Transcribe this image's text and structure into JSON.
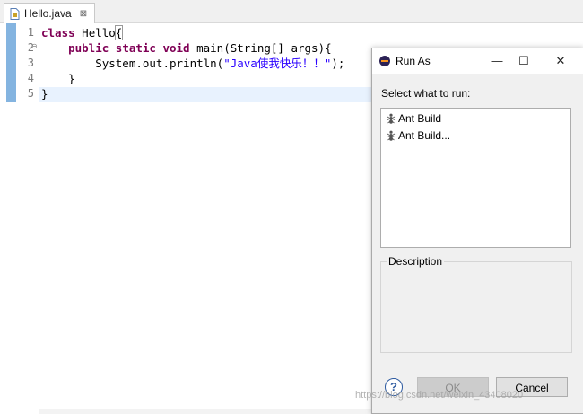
{
  "tab": {
    "title": "Hello.java",
    "close": "⊠"
  },
  "editor": {
    "line_numbers": [
      "1",
      "2",
      "3",
      "4",
      "5"
    ],
    "fold_marker": "⊖",
    "lines": {
      "l1_kw": "class",
      "l1_rest": " Hello",
      "l1_brace": "{",
      "l2_indent": "    ",
      "l2_kw": "public static void",
      "l2_rest": " main(String[] args){",
      "l3_pre": "        System.out.println(",
      "l3_str": "\"Java使我快乐！！\"",
      "l3_post": ");",
      "l4": "    }",
      "l5": "}"
    }
  },
  "dialog": {
    "title": "Run As",
    "minimize": "—",
    "maximize": "☐",
    "close": "✕",
    "prompt": "Select what to run:",
    "items": [
      {
        "label": "Ant Build",
        "icon": "ant-icon"
      },
      {
        "label": "Ant Build...",
        "icon": "ant-icon"
      }
    ],
    "description_label": "Description",
    "help": "?",
    "ok_label": "OK",
    "cancel_label": "Cancel"
  },
  "watermark": "https://blog.csdn.net/weixin_43408020"
}
